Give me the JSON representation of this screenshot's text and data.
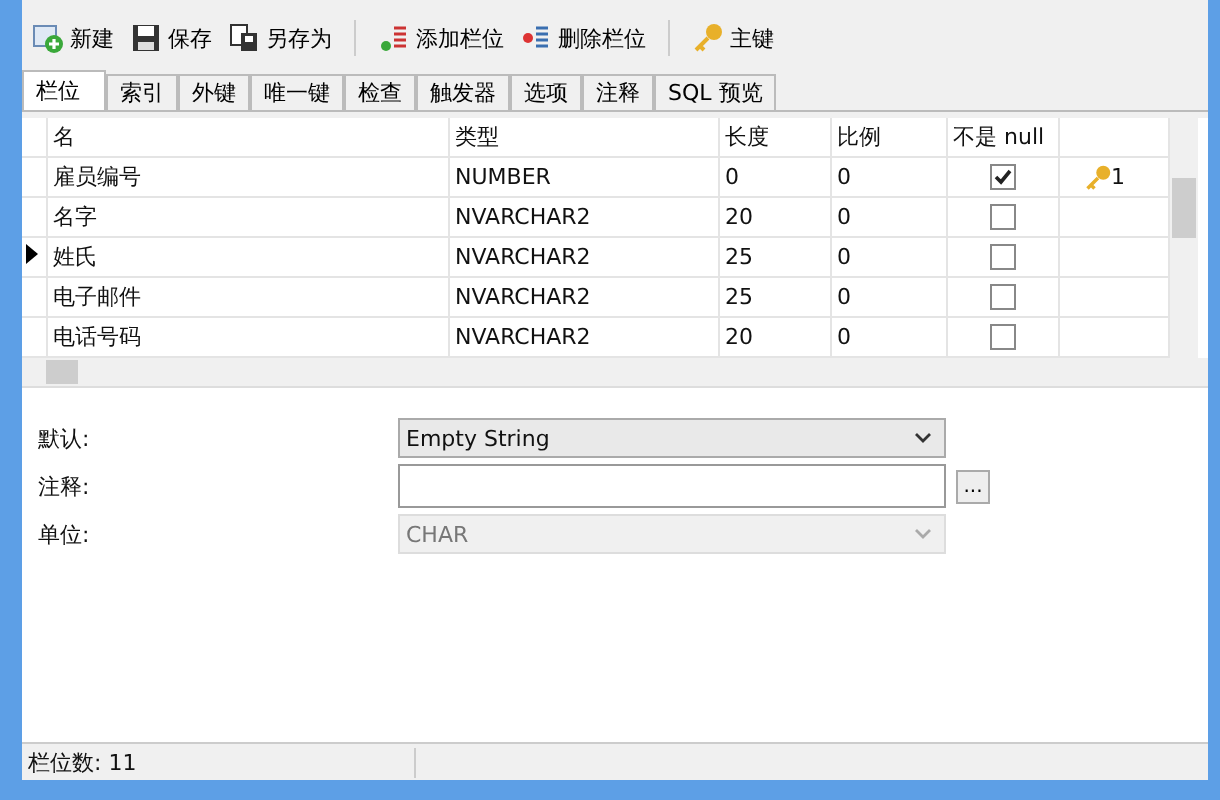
{
  "toolbar": [
    {
      "kind": "new",
      "label": "新建"
    },
    {
      "kind": "save",
      "label": "保存"
    },
    {
      "kind": "saveas",
      "label": "另存为"
    },
    {
      "kind": "sep"
    },
    {
      "kind": "addcol",
      "label": "添加栏位"
    },
    {
      "kind": "delcol",
      "label": "删除栏位"
    },
    {
      "kind": "sep"
    },
    {
      "kind": "key",
      "label": "主键"
    }
  ],
  "tabs": [
    {
      "label": "栏位",
      "selected": true
    },
    {
      "label": "索引",
      "selected": false
    },
    {
      "label": "外键",
      "selected": false
    },
    {
      "label": "唯一键",
      "selected": false
    },
    {
      "label": "检查",
      "selected": false
    },
    {
      "label": "触发器",
      "selected": false
    },
    {
      "label": "选项",
      "selected": false
    },
    {
      "label": "注释",
      "selected": false
    },
    {
      "label": "SQL 预览",
      "selected": false
    }
  ],
  "table": {
    "columns": [
      "名",
      "类型",
      "长度",
      "比例",
      "不是 null"
    ],
    "rows": [
      {
        "name": "雇员编号",
        "type": "NUMBER",
        "length": "0",
        "scale": "0",
        "not_null": true,
        "key": "1",
        "current": false
      },
      {
        "name": "名字",
        "type": "NVARCHAR2",
        "length": "20",
        "scale": "0",
        "not_null": false,
        "current": false
      },
      {
        "name": "姓氏",
        "type": "NVARCHAR2",
        "length": "25",
        "scale": "0",
        "not_null": false,
        "current": true
      },
      {
        "name": "电子邮件",
        "type": "NVARCHAR2",
        "length": "25",
        "scale": "0",
        "not_null": false,
        "current": false
      },
      {
        "name": "电话号码",
        "type": "NVARCHAR2",
        "length": "20",
        "scale": "0",
        "not_null": false,
        "current": false
      }
    ]
  },
  "form": [
    {
      "label": "默认:",
      "kind": "select",
      "value": "Empty String",
      "disabled": false
    },
    {
      "label": "注释:",
      "kind": "text",
      "button": "..."
    },
    {
      "label": "单位:",
      "kind": "select",
      "value": "CHAR",
      "disabled": true
    }
  ],
  "status_bar": "栏位数: 11"
}
